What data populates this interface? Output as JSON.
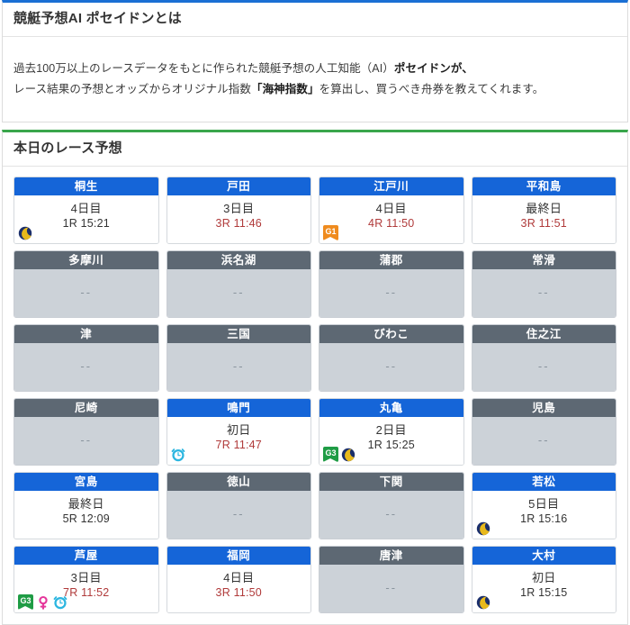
{
  "about": {
    "title": "競艇予想AI ポセイドンとは",
    "paragraph_line1_pre": "過去100万以上のレースデータをもとに作られた競艇予想の人工知能（AI）",
    "paragraph_line1_bold": "ポセイドンが、",
    "paragraph_line2_pre": "レース結果の予想とオッズからオリジナル指数",
    "paragraph_line2_bold": "「海神指数」",
    "paragraph_line2_post": "を算出し、買うべき舟券を教えてくれます。",
    "accent_color": "#1a6fd4"
  },
  "today": {
    "title": "本日のレース予想",
    "accent_color": "#3aa64c",
    "empty_text": "--",
    "active_header_color": "#1565d8",
    "inactive_header_color": "#5d6873",
    "inactive_body_color": "#ccd2d8",
    "race_time_color": "#b03a3a",
    "venues": [
      {
        "name": "桐生",
        "active": true,
        "day": "4日目",
        "race": "1R 15:21",
        "race_dark": true,
        "badges": [
          "moon-icon"
        ]
      },
      {
        "name": "戸田",
        "active": true,
        "day": "3日目",
        "race": "3R 11:46",
        "race_dark": false,
        "badges": []
      },
      {
        "name": "江戸川",
        "active": true,
        "day": "4日目",
        "race": "4R 11:50",
        "race_dark": false,
        "badges": [
          "g1-badge"
        ]
      },
      {
        "name": "平和島",
        "active": true,
        "day": "最終日",
        "race": "3R 11:51",
        "race_dark": false,
        "badges": []
      },
      {
        "name": "多摩川",
        "active": false,
        "day": "--",
        "race": "",
        "race_dark": true,
        "badges": []
      },
      {
        "name": "浜名湖",
        "active": false,
        "day": "--",
        "race": "",
        "race_dark": true,
        "badges": []
      },
      {
        "name": "蒲郡",
        "active": false,
        "day": "--",
        "race": "",
        "race_dark": true,
        "badges": []
      },
      {
        "name": "常滑",
        "active": false,
        "day": "--",
        "race": "",
        "race_dark": true,
        "badges": []
      },
      {
        "name": "津",
        "active": false,
        "day": "--",
        "race": "",
        "race_dark": true,
        "badges": []
      },
      {
        "name": "三国",
        "active": false,
        "day": "--",
        "race": "",
        "race_dark": true,
        "badges": []
      },
      {
        "name": "びわこ",
        "active": false,
        "day": "--",
        "race": "",
        "race_dark": true,
        "badges": []
      },
      {
        "name": "住之江",
        "active": false,
        "day": "--",
        "race": "",
        "race_dark": true,
        "badges": []
      },
      {
        "name": "尼崎",
        "active": false,
        "day": "--",
        "race": "",
        "race_dark": true,
        "badges": []
      },
      {
        "name": "鳴門",
        "active": true,
        "day": "初日",
        "race": "7R 11:47",
        "race_dark": false,
        "badges": [
          "clock-icon"
        ]
      },
      {
        "name": "丸亀",
        "active": true,
        "day": "2日目",
        "race": "1R 15:25",
        "race_dark": true,
        "badges": [
          "g3-badge",
          "moon-icon"
        ]
      },
      {
        "name": "児島",
        "active": false,
        "day": "--",
        "race": "",
        "race_dark": true,
        "badges": []
      },
      {
        "name": "宮島",
        "active": true,
        "day": "最終日",
        "race": "5R 12:09",
        "race_dark": true,
        "badges": []
      },
      {
        "name": "徳山",
        "active": false,
        "day": "--",
        "race": "",
        "race_dark": true,
        "badges": []
      },
      {
        "name": "下関",
        "active": false,
        "day": "--",
        "race": "",
        "race_dark": true,
        "badges": []
      },
      {
        "name": "若松",
        "active": true,
        "day": "5日目",
        "race": "1R 15:16",
        "race_dark": true,
        "badges": [
          "moon-icon"
        ]
      },
      {
        "name": "芦屋",
        "active": true,
        "day": "3日目",
        "race": "7R 11:52",
        "race_dark": false,
        "badges": [
          "g3-badge",
          "female-icon",
          "clock-icon"
        ]
      },
      {
        "name": "福岡",
        "active": true,
        "day": "4日目",
        "race": "3R 11:50",
        "race_dark": false,
        "badges": []
      },
      {
        "name": "唐津",
        "active": false,
        "day": "--",
        "race": "",
        "race_dark": true,
        "badges": []
      },
      {
        "name": "大村",
        "active": true,
        "day": "初日",
        "race": "1R 15:15",
        "race_dark": true,
        "badges": [
          "moon-icon"
        ]
      }
    ],
    "badge_labels": {
      "g1-badge": "G1",
      "g3-badge": "G3"
    },
    "badge_colors": {
      "g1-badge": "#ef8b1e",
      "g3-badge": "#1f9c45",
      "moon-icon": "#e8b91c",
      "clock-icon": "#2cb6e0",
      "female-icon": "#e5379b"
    }
  }
}
